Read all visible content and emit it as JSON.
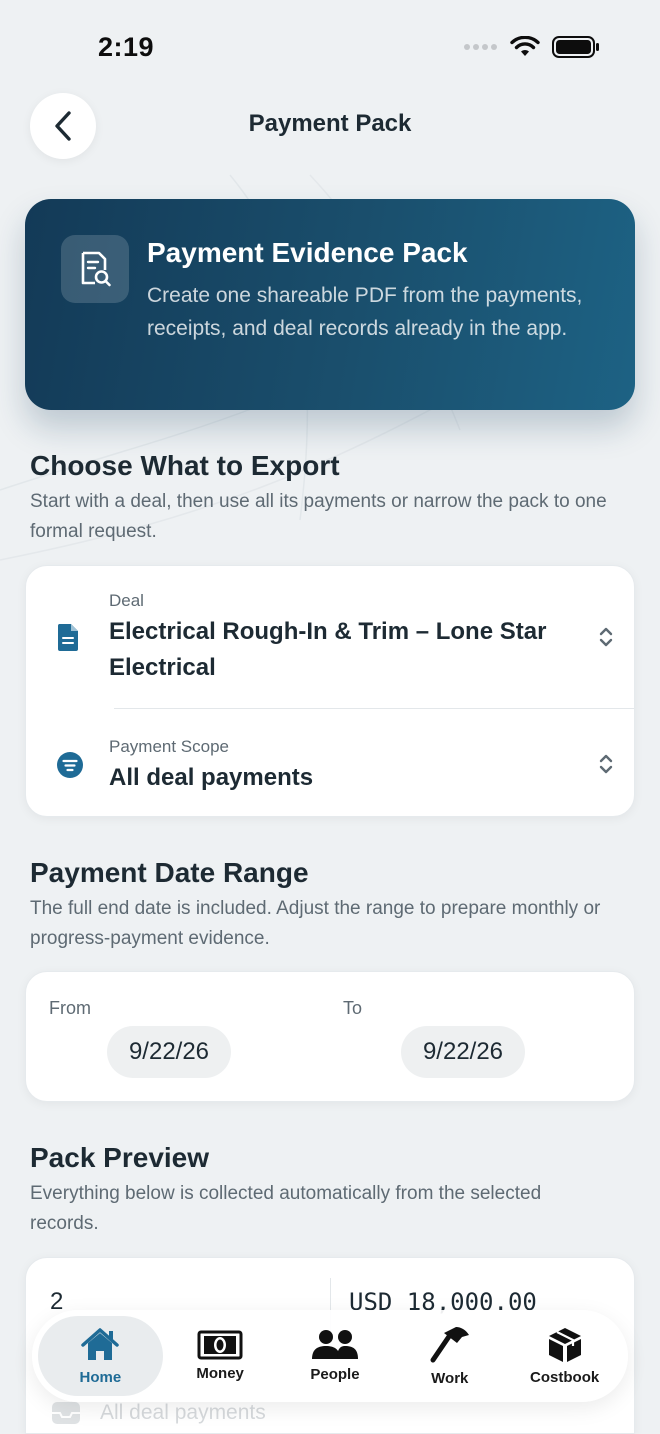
{
  "status": {
    "time": "2:19"
  },
  "header": {
    "title": "Payment Pack"
  },
  "hero": {
    "title": "Payment Evidence Pack",
    "description": "Create one shareable PDF from the payments, receipts, and deal records already in the app."
  },
  "export_section": {
    "title": "Choose What to Export",
    "subtitle": "Start with a deal, then use all its payments or narrow the pack to one formal request.",
    "deal": {
      "label": "Deal",
      "value": "Electrical Rough-In & Trim – Lone Star Electrical"
    },
    "scope": {
      "label": "Payment Scope",
      "value": "All deal payments"
    }
  },
  "date_section": {
    "title": "Payment Date Range",
    "subtitle": "The full end date is included. Adjust the range to prepare monthly or progress-payment evidence.",
    "from_label": "From",
    "from_value": "9/22/26",
    "to_label": "To",
    "to_value": "9/22/26"
  },
  "preview_section": {
    "title": "Pack Preview",
    "subtitle": "Everything below is collected automatically from the selected records.",
    "count": "2",
    "amount": "USD 18,000.00",
    "scope_row": "All deal payments"
  },
  "tabs": [
    {
      "label": "Home",
      "icon": "house-icon",
      "active": true
    },
    {
      "label": "Money",
      "icon": "banknote-icon",
      "active": false
    },
    {
      "label": "People",
      "icon": "people-icon",
      "active": false
    },
    {
      "label": "Work",
      "icon": "hammer-icon",
      "active": false
    },
    {
      "label": "Costbook",
      "icon": "box-icon",
      "active": false
    }
  ],
  "colors": {
    "accent": "#1f6b96",
    "hero_start": "#133a57",
    "hero_end": "#1d6284",
    "background": "#eef1f3"
  }
}
